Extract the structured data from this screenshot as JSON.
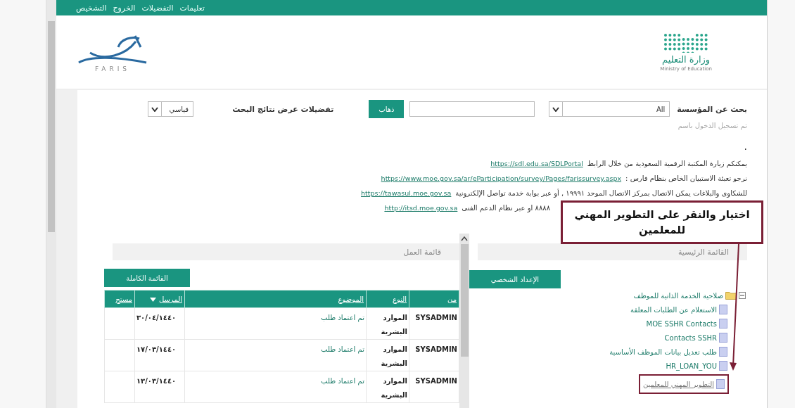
{
  "top_nav": {
    "links": [
      "تعليمات",
      "التفضيلات",
      "الخروج",
      "التشخيص"
    ]
  },
  "header": {
    "ministry_name": "وزارة التعليم",
    "ministry_name_en": "Ministry of Education",
    "system_logo_text": "FARIS"
  },
  "search": {
    "label": "بحث عن المؤسسة",
    "scope_value": "All",
    "go_button": "ذهاب",
    "preferences_label": "تفضيلات عرض نتائج البحث",
    "preferences_value": "قياسي"
  },
  "login_note": "تم تسجيل الدخول باسم",
  "bullet": ".",
  "notices": [
    {
      "text": "يمكنكم زيارة المكتبة الرقمية السعودية من خلال الرابط",
      "link": "https://sdl.edu.sa/SDLPortal"
    },
    {
      "text": "نرجو تعبئة الاستبيان الخاص بنظام فارس :",
      "link": "https://www.moe.gov.sa/ar/eParticipation/survey/Pages/farissurvey.aspx"
    },
    {
      "text": "للشكاوى والبلاغات يمكن الاتصال بمركز الاتصال الموحد ١٩٩٩١ , أو عبر بوابة خدمة تواصل الإلكترونية",
      "link": "https://tawasul.moe.gov.sa"
    },
    {
      "text": "٨٨٨٨ او عبر نظام الدعم الفنى",
      "link": "http://itsd.moe.gov.sa"
    }
  ],
  "callout": {
    "text": "اختيار والنقر على التطوير المهني للمعلمين"
  },
  "main_menu": {
    "title": "القائمة الرئيسية",
    "button": "الإعداد الشخصي",
    "tree": [
      {
        "label": "صلاحية الخدمة الذاتية للموظف",
        "kind": "folder",
        "expanded": true,
        "highlighted": false,
        "children": [
          {
            "label": "الاستعلام عن الطلبات المعلقة",
            "kind": "page",
            "highlighted": false
          },
          {
            "label": "MOE SSHR Contacts",
            "kind": "page",
            "highlighted": false
          },
          {
            "label": "Contacts SSHR",
            "kind": "page",
            "highlighted": false
          },
          {
            "label": "طلب تعديل بيانات الموظف الأساسية",
            "kind": "page",
            "highlighted": false
          },
          {
            "label": "HR_LOAN_YOU",
            "kind": "page",
            "highlighted": false
          },
          {
            "label": "التطوير المهني للمعلمين",
            "kind": "page",
            "highlighted": true
          }
        ]
      }
    ]
  },
  "worklist": {
    "title": "قائمة العمل",
    "button": "القائمة الكاملة",
    "columns": [
      {
        "label": "من",
        "sorted": false
      },
      {
        "label": "النوع",
        "sorted": false
      },
      {
        "label": "الموضوع",
        "sorted": false
      },
      {
        "label": "المرسل",
        "sorted": true
      },
      {
        "label": "مستح",
        "sorted": false
      }
    ],
    "rows": [
      {
        "from": "SYSADMIN",
        "type": "الموارد البشرية",
        "subject": "تم اعتماد طلب",
        "sent": "٣٠/٠٤/١٤٤٠"
      },
      {
        "from": "SYSADMIN",
        "type": "الموارد البشرية",
        "subject": "تم اعتماد طلب",
        "sent": "١٧/٠٣/١٤٤٠"
      },
      {
        "from": "SYSADMIN",
        "type": "الموارد البشرية",
        "subject": "تم اعتماد طلب",
        "sent": "١٣/٠٣/١٤٤٠"
      }
    ]
  }
}
